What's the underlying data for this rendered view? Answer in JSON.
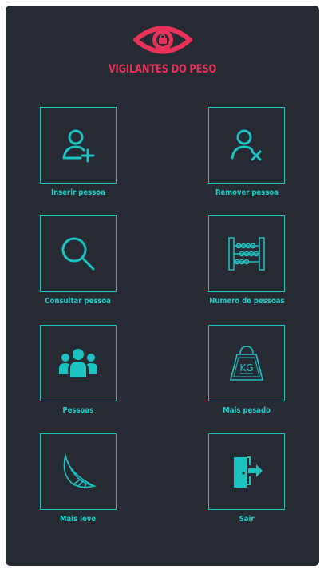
{
  "app": {
    "title": "VIGILANTES DO PESO"
  },
  "colors": {
    "background": "#262b33",
    "accent": "#1cc3c0",
    "brand": "#e8325a"
  },
  "menu": [
    {
      "label": "Inserir pessoa",
      "icon": "add-user-icon"
    },
    {
      "label": "Remover pessoa",
      "icon": "remove-user-icon"
    },
    {
      "label": "Consultar pessoa",
      "icon": "search-icon"
    },
    {
      "label": "Numero de pessoas",
      "icon": "abacus-icon"
    },
    {
      "label": "Pessoas",
      "icon": "people-group-icon"
    },
    {
      "label": "Mais pesado",
      "icon": "kg-weight-icon"
    },
    {
      "label": "Mais leve",
      "icon": "feather-icon"
    },
    {
      "label": "Sair",
      "icon": "exit-door-icon"
    }
  ]
}
